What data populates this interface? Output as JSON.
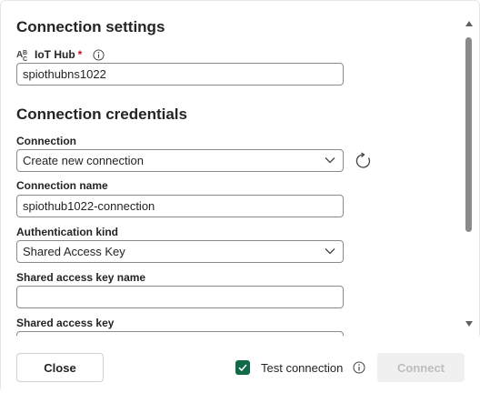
{
  "settings": {
    "title": "Connection settings",
    "iot_hub_label": "IoT Hub",
    "required_mark": "*",
    "iot_hub_value": "spiothubns1022"
  },
  "credentials": {
    "title": "Connection credentials",
    "connection_label": "Connection",
    "connection_value": "Create new connection",
    "connection_name_label": "Connection name",
    "connection_name_value": "spiothub1022-connection",
    "auth_kind_label": "Authentication kind",
    "auth_kind_value": "Shared Access Key",
    "sak_name_label": "Shared access key name",
    "sak_name_value": "",
    "sak_label": "Shared access key",
    "sak_value": ""
  },
  "footer": {
    "close_label": "Close",
    "test_connection_label": "Test connection",
    "test_connection_checked": true,
    "connect_label": "Connect"
  },
  "colors": {
    "accent": "#0f6b46",
    "required": "#c50f1f",
    "disabled_bg": "#f0f0f0",
    "disabled_text": "#bdbdbd"
  }
}
